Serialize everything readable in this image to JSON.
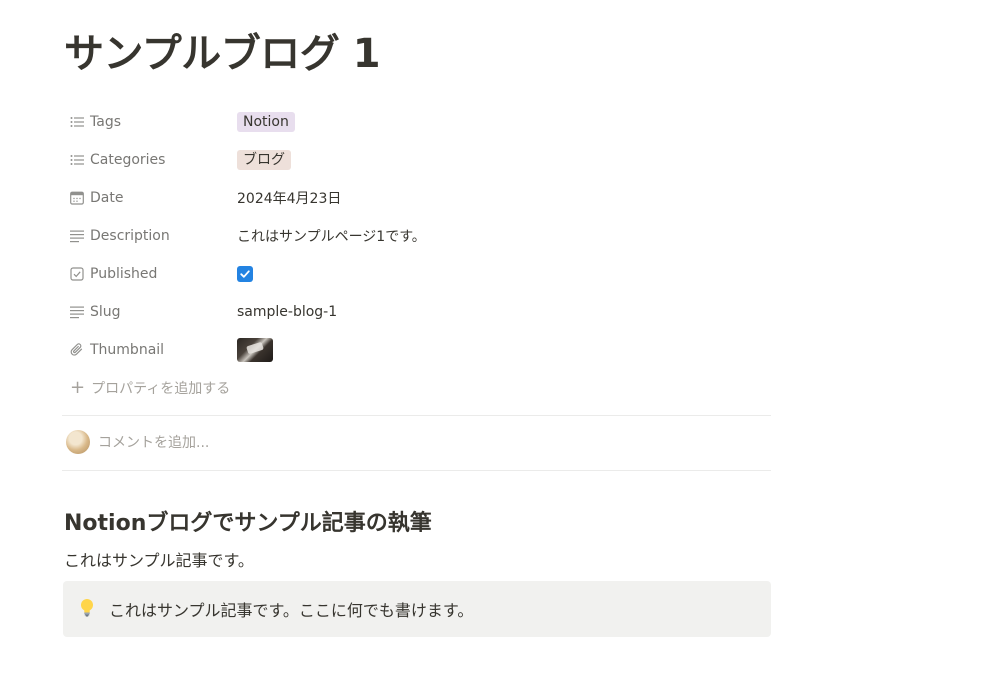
{
  "page": {
    "title": "サンプルブログ 1"
  },
  "properties": [
    {
      "key": "Tags",
      "icon": "list-icon",
      "type": "tag",
      "value": "Notion",
      "tag_bg": "#e8deee"
    },
    {
      "key": "Categories",
      "icon": "list-icon",
      "type": "tag",
      "value": "ブログ",
      "tag_bg": "#eee0da"
    },
    {
      "key": "Date",
      "icon": "calendar-icon",
      "type": "text",
      "value": "2024年4月23日"
    },
    {
      "key": "Description",
      "icon": "text-lines-icon",
      "type": "text",
      "value": "これはサンプルページ1です。"
    },
    {
      "key": "Published",
      "icon": "checkbox-icon",
      "type": "checkbox",
      "value": "checked"
    },
    {
      "key": "Slug",
      "icon": "text-lines-icon",
      "type": "text",
      "value": "sample-blog-1"
    },
    {
      "key": "Thumbnail",
      "icon": "paperclip-icon",
      "type": "image",
      "value": "thumbnail-image"
    }
  ],
  "add_property_label": "プロパティを追加する",
  "comment": {
    "placeholder": "コメントを追加..."
  },
  "content": {
    "heading": "Notionブログでサンプル記事の執筆",
    "paragraph": "これはサンプル記事です。",
    "callout": {
      "icon": "lightbulb-icon",
      "text": "これはサンプル記事です。ここに何でも書けます。"
    }
  },
  "colors": {
    "text": "#37352f",
    "muted": "#787774",
    "placeholder": "#a5a29c",
    "checkbox": "#2383e2",
    "callout_bg": "#f1f1ef"
  }
}
